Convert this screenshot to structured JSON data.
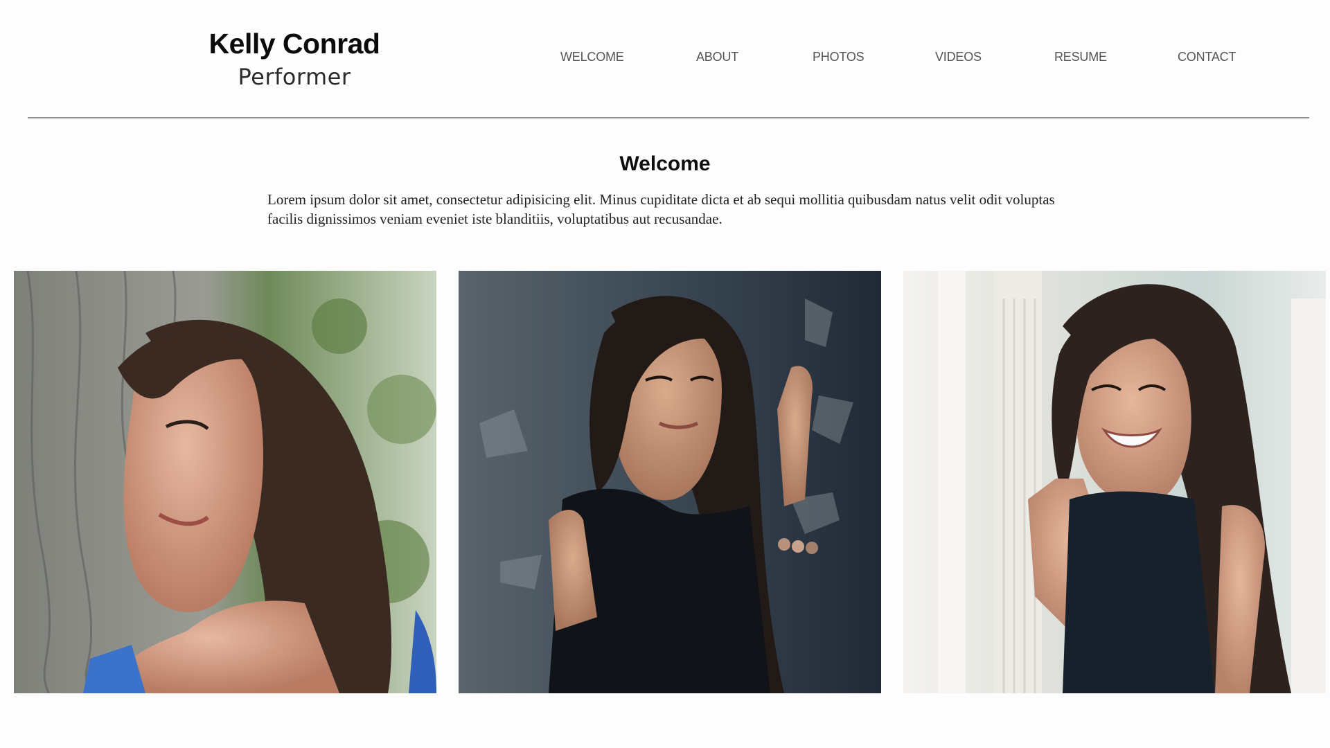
{
  "brand": {
    "name": "Kelly Conrad",
    "subtitle": "Performer"
  },
  "nav": [
    {
      "label": "WELCOME"
    },
    {
      "label": "ABOUT"
    },
    {
      "label": "PHOTOS"
    },
    {
      "label": "VIDEOS"
    },
    {
      "label": "RESUME"
    },
    {
      "label": "CONTACT"
    }
  ],
  "welcome": {
    "title": "Welcome",
    "body": "Lorem ipsum dolor sit amet, consectetur adipisicing elit. Minus cupiditate dicta et ab sequi mollitia quibusdam natus velit odit voluptas facilis dignissimos veniam eveniet iste blanditiis, voluptatibus aut recusandae."
  },
  "gallery": {
    "photos": [
      {
        "subject": "woman-profile-by-tree",
        "background": "#8b8f86",
        "accent": "#2f5fb8"
      },
      {
        "subject": "woman-leaning-on-wall",
        "background": "#3d4a58",
        "accent": "#141a20"
      },
      {
        "subject": "woman-smiling-by-door",
        "background": "#e8ecea",
        "accent": "#17212b"
      }
    ]
  }
}
